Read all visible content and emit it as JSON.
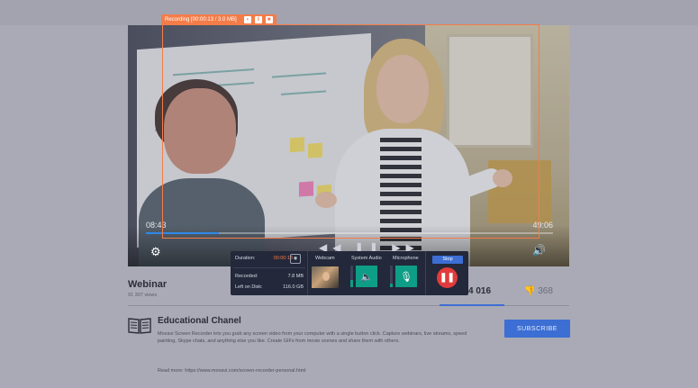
{
  "recording_bar": {
    "label": "Recording [00:00:13 / 3.0 MB]"
  },
  "player": {
    "time_current": "08:43",
    "time_total": "49:06",
    "progress": 0.18
  },
  "recorder_panel": {
    "duration_label": "Duration:",
    "duration_value": "00:00:13",
    "recorded_label": "Recorded:",
    "recorded_value": "7.8 MB",
    "left_label": "Left on Disk:",
    "left_value": "116.0 GB",
    "webcam_title": "Webcam",
    "system_audio_title": "System Audio",
    "microphone_title": "Microphone",
    "stop_label": "Stop",
    "system_audio_level": 0.35,
    "microphone_level": 0.15
  },
  "video_info": {
    "title": "Webinar",
    "views": "91 307 views",
    "likes": "4 016",
    "dislikes": "368"
  },
  "channel": {
    "name": "Educational Chanel",
    "description": "Movavi Screen Recorder lets you grab any screen video from your computer with a single button click. Capture webinars, live streams, speed painting, Skype chats, and anything else you like. Create GIFs from movie scenes and share them with others.",
    "read_more": "Read more: https://www.movavi.com/screen-recorder-personal.html",
    "subscribe_label": "SUBSCRIBE"
  },
  "colors": {
    "accent": "#f47c49",
    "brand_blue": "#3c6ed4",
    "tile_green": "#0e9d86",
    "pause_red": "#e23b3b"
  },
  "icons": [
    "settings-icon",
    "volume-icon",
    "camera-icon",
    "speaker-icon",
    "microphone-icon",
    "pause-icon",
    "like-icon",
    "dislike-icon",
    "book-icon"
  ]
}
